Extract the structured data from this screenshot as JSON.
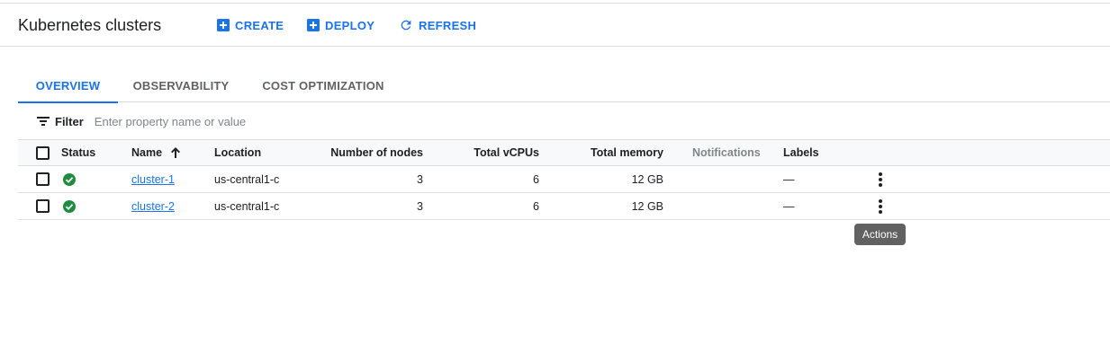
{
  "header": {
    "title": "Kubernetes clusters",
    "create_label": "CREATE",
    "deploy_label": "DEPLOY",
    "refresh_label": "REFRESH"
  },
  "tabs": [
    {
      "label": "OVERVIEW",
      "active": true
    },
    {
      "label": "OBSERVABILITY",
      "active": false
    },
    {
      "label": "COST OPTIMIZATION",
      "active": false
    }
  ],
  "filter": {
    "label": "Filter",
    "placeholder": "Enter property name or value"
  },
  "table": {
    "columns": {
      "status": "Status",
      "name": "Name",
      "location": "Location",
      "nodes": "Number of nodes",
      "vcpus": "Total vCPUs",
      "memory": "Total memory",
      "notifications": "Notifications",
      "labels": "Labels"
    },
    "rows": [
      {
        "name": "cluster-1",
        "location": "us-central1-c",
        "nodes": "3",
        "vcpus": "6",
        "memory": "12 GB",
        "labels": "—",
        "status_icon": "check-circle-icon"
      },
      {
        "name": "cluster-2",
        "location": "us-central1-c",
        "nodes": "3",
        "vcpus": "6",
        "memory": "12 GB",
        "labels": "—",
        "status_icon": "check-circle-icon"
      }
    ]
  },
  "tooltip": {
    "text": "Actions"
  },
  "colors": {
    "accent": "#1a73e8",
    "success": "#1e8e3e",
    "tooltip_bg": "#616161"
  }
}
